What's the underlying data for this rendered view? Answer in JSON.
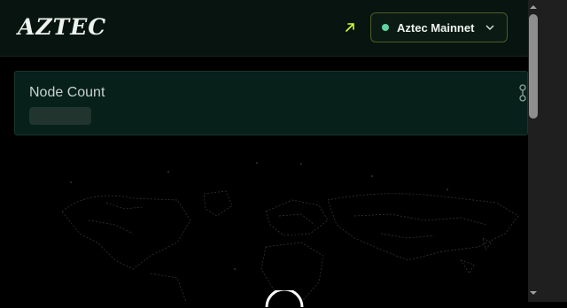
{
  "header": {
    "logo_text": "AZTEC",
    "network": {
      "label": "Aztec Mainnet",
      "status_color": "#5fd3a0"
    }
  },
  "card": {
    "title": "Node Count",
    "value_loading": true
  },
  "colors": {
    "accent": "#d4ff2a",
    "background": "#000000",
    "header_bg": "#07140f",
    "card_bg": "#07201a"
  },
  "icons": {
    "external": "arrow-up-right-icon",
    "dropdown": "chevron-down-icon",
    "link": "link-icon"
  }
}
